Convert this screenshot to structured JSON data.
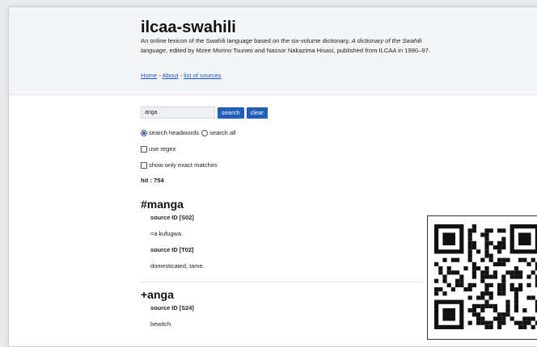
{
  "site": {
    "title": "ilcaa-swahili",
    "description_1": "An online lexicon of the Swahili language based on the six-volume dictionary, ",
    "description_italic": "A dictionary of the Swahili language",
    "description_2": ", edited by Mzee Morino Tsuneo and Nassor Nakazima Hisasi, published from ILCAA in 1990–97.",
    "nav": {
      "home": "Home",
      "sep1": " - ",
      "about": "About",
      "sep2": " - ",
      "sources": "list of sources"
    }
  },
  "search": {
    "value": "anga",
    "search_label": "search",
    "clear_label": "clear",
    "radio_headwords": "search headwords",
    "radio_all": "search all",
    "use_regex": "use regex",
    "exact": "show only exact matches",
    "hits": "hit : 754"
  },
  "entries": [
    {
      "headword": "#manga",
      "senses": [
        {
          "source": "source ID [S02]",
          "text": "=a kufugwa."
        },
        {
          "source": "source ID [T02]",
          "text": "domesticated, tame."
        }
      ]
    },
    {
      "headword": "+anga",
      "senses": [
        {
          "source": "source ID [S24]",
          "text": "bewitch."
        }
      ]
    }
  ],
  "qr": {
    "icon": "qr-code-icon"
  }
}
